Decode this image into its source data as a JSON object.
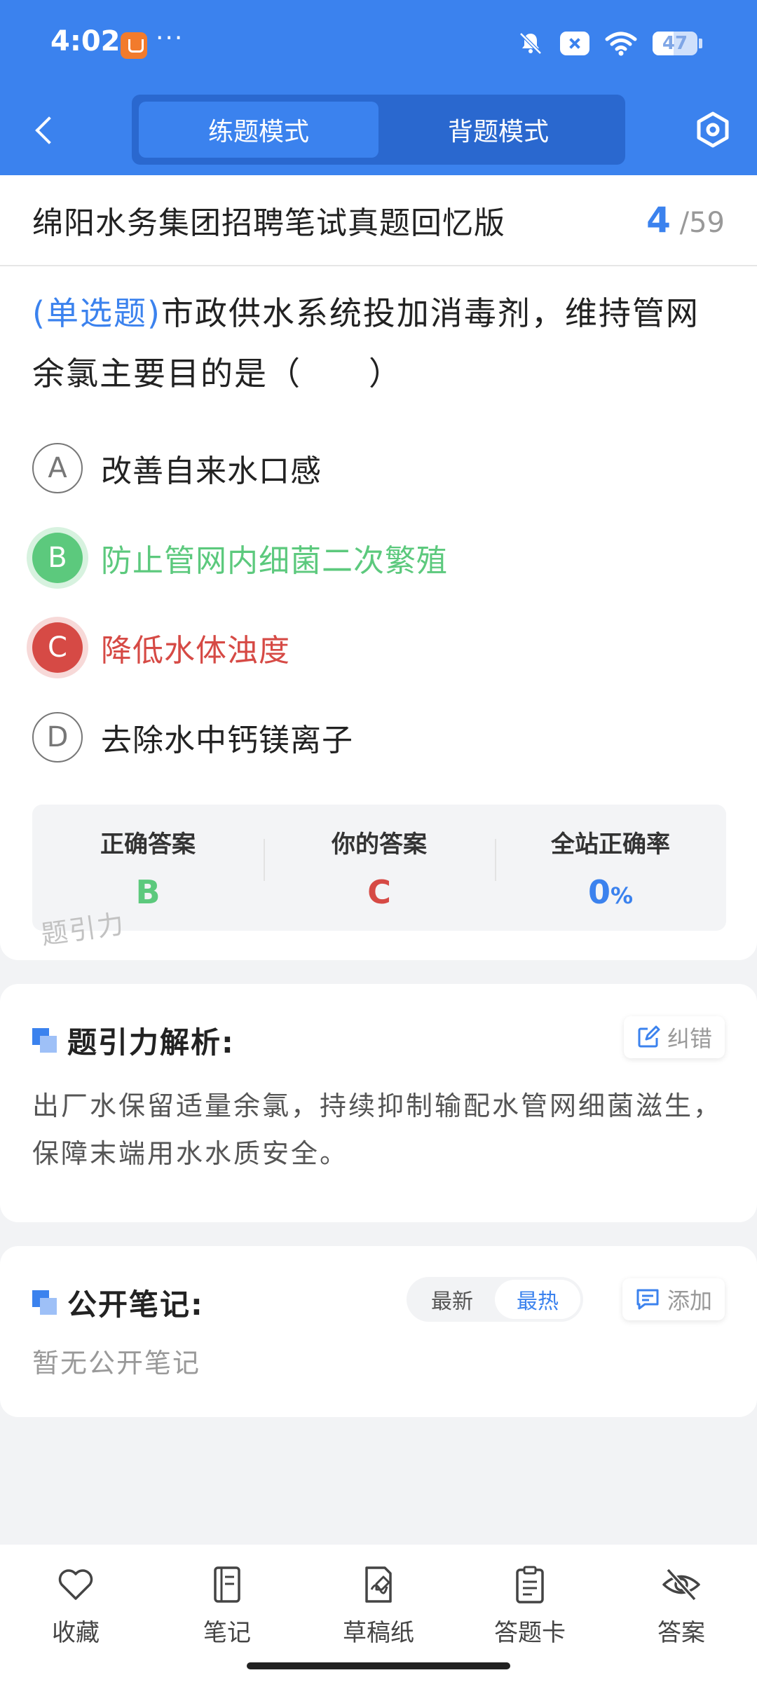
{
  "status_bar": {
    "time": "4:02",
    "dots": "···",
    "battery": "47",
    "battery_level": 0.47
  },
  "nav": {
    "tabs": [
      {
        "label": "练题模式",
        "active": true
      },
      {
        "label": "背题模式",
        "active": false
      }
    ]
  },
  "exam": {
    "title": "绵阳水务集团招聘笔试真题回忆版",
    "current": "4",
    "separator": "/",
    "total": "59"
  },
  "question": {
    "type": "(单选题)",
    "text": "市政供水系统投加消毒剂，维持管网余氯主要目的是（　　）",
    "options": [
      {
        "letter": "A",
        "text": "改善自来水口感",
        "state": "normal"
      },
      {
        "letter": "B",
        "text": "防止管网内细菌二次繁殖",
        "state": "correct"
      },
      {
        "letter": "C",
        "text": "降低水体浊度",
        "state": "wrong"
      },
      {
        "letter": "D",
        "text": "去除水中钙镁离子",
        "state": "normal"
      }
    ]
  },
  "answer_summary": {
    "correct_label": "正确答案",
    "correct_value": "B",
    "yours_label": "你的答案",
    "yours_value": "C",
    "rate_label": "全站正确率",
    "rate_value": "0",
    "rate_unit": "%",
    "watermark": "题引力"
  },
  "analysis": {
    "title": "题引力解析:",
    "correct_button": "纠错",
    "text": "出厂水保留适量余氯，持续抑制输配水管网细菌滋生，保障末端用水水质安全。"
  },
  "notes": {
    "title": "公开笔记:",
    "sort_options": [
      "最新",
      "最热"
    ],
    "sort_active": "最热",
    "add_button": "添加",
    "empty_text": "暂无公开笔记"
  },
  "bottom_nav": [
    {
      "label": "收藏",
      "icon": "heart-icon"
    },
    {
      "label": "笔记",
      "icon": "notebook-icon"
    },
    {
      "label": "草稿纸",
      "icon": "draft-paper-icon"
    },
    {
      "label": "答题卡",
      "icon": "answer-card-icon"
    },
    {
      "label": "答案",
      "icon": "eye-off-icon"
    }
  ],
  "colors": {
    "primary": "#3b82ee",
    "correct": "#5cc97d",
    "wrong": "#d64a45"
  }
}
